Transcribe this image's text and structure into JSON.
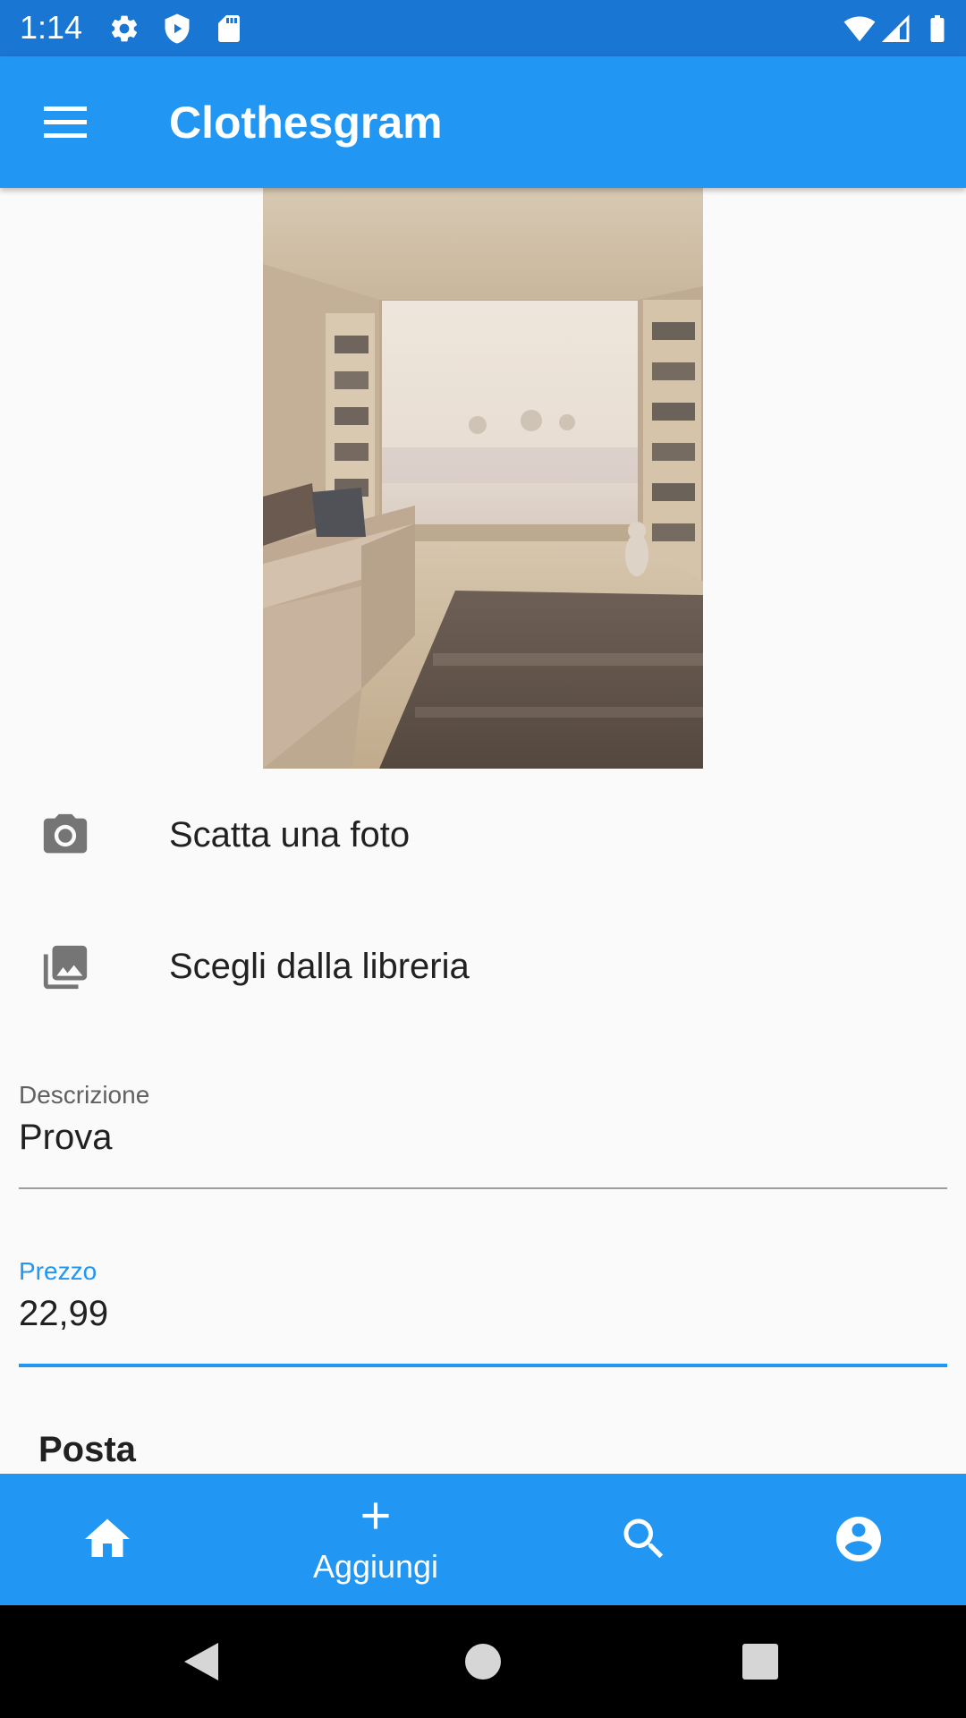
{
  "status_bar": {
    "time": "1:14",
    "icons": [
      "gear-icon",
      "shield-icon",
      "sd-card-icon",
      "wifi-icon",
      "signal-icon",
      "battery-icon"
    ]
  },
  "app_bar": {
    "title": "Clothesgram",
    "menu_icon": "menu-icon"
  },
  "actions": [
    {
      "label": "Scatta una foto",
      "icon": "camera-icon"
    },
    {
      "label": "Scegli dalla libreria",
      "icon": "photo-library-icon"
    }
  ],
  "form": {
    "description": {
      "label": "Descrizione",
      "value": "Prova"
    },
    "price": {
      "label": "Prezzo",
      "value": "22,99"
    }
  },
  "section": {
    "title": "Posta"
  },
  "bottom_nav": {
    "items": [
      {
        "icon": "home-icon",
        "label": ""
      },
      {
        "icon": "add-icon",
        "label": "Aggiungi"
      },
      {
        "icon": "search-icon",
        "label": ""
      },
      {
        "icon": "account-circle-icon",
        "label": ""
      }
    ]
  },
  "colors": {
    "primary": "#2196f3",
    "status_bar": "#1976d2",
    "background": "#fafafa",
    "focus_underline": "#2196f3"
  }
}
